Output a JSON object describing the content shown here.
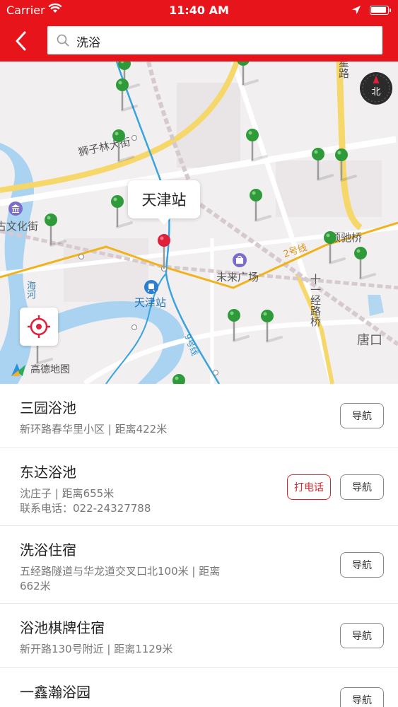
{
  "status_bar": {
    "carrier": "Carrier",
    "time": "11:40 AM"
  },
  "header": {
    "search_value": "洗浴"
  },
  "map": {
    "callout": "天津站",
    "compass_label": "北",
    "provider": "高德地图",
    "labels": {
      "street_shizilin": "狮子林大街",
      "culture": "古文化街",
      "tianjin_station": "天津站",
      "weilai_plaza": "未来广场",
      "shunchi_bridge": "顺驰桥",
      "line2": "2号线",
      "line9": "9号线",
      "haihe": "海河",
      "jingluqiao": "十一经路桥",
      "tangkou": "唐口",
      "road_top": "星路"
    }
  },
  "results": [
    {
      "name": "三园浴池",
      "line1": "新环路春华里小区 | 距离422米",
      "line2": "",
      "nav_label": "导航",
      "call_label": ""
    },
    {
      "name": "东达浴池",
      "line1": "沈庄子 | 距离655米",
      "line2": "联系电话：022-24327788",
      "nav_label": "导航",
      "call_label": "打电话"
    },
    {
      "name": "洗浴住宿",
      "line1": "五经路隧道与华龙道交叉口北100米 | 距离",
      "line2": "662米",
      "nav_label": "导航",
      "call_label": ""
    },
    {
      "name": "浴池棋牌住宿",
      "line1": "新开路130号附近 | 距离1129米",
      "line2": "",
      "nav_label": "导航",
      "call_label": ""
    },
    {
      "name": "一鑫瀚浴园",
      "line1": "",
      "line2": "",
      "nav_label": "导航",
      "call_label": ""
    }
  ],
  "colors": {
    "brand_red": "#e8141c",
    "pin_green": "#2f9a3a",
    "pin_red": "#e0203a",
    "metro_yellow": "#f1b31c",
    "river": "#a9d3f0"
  }
}
